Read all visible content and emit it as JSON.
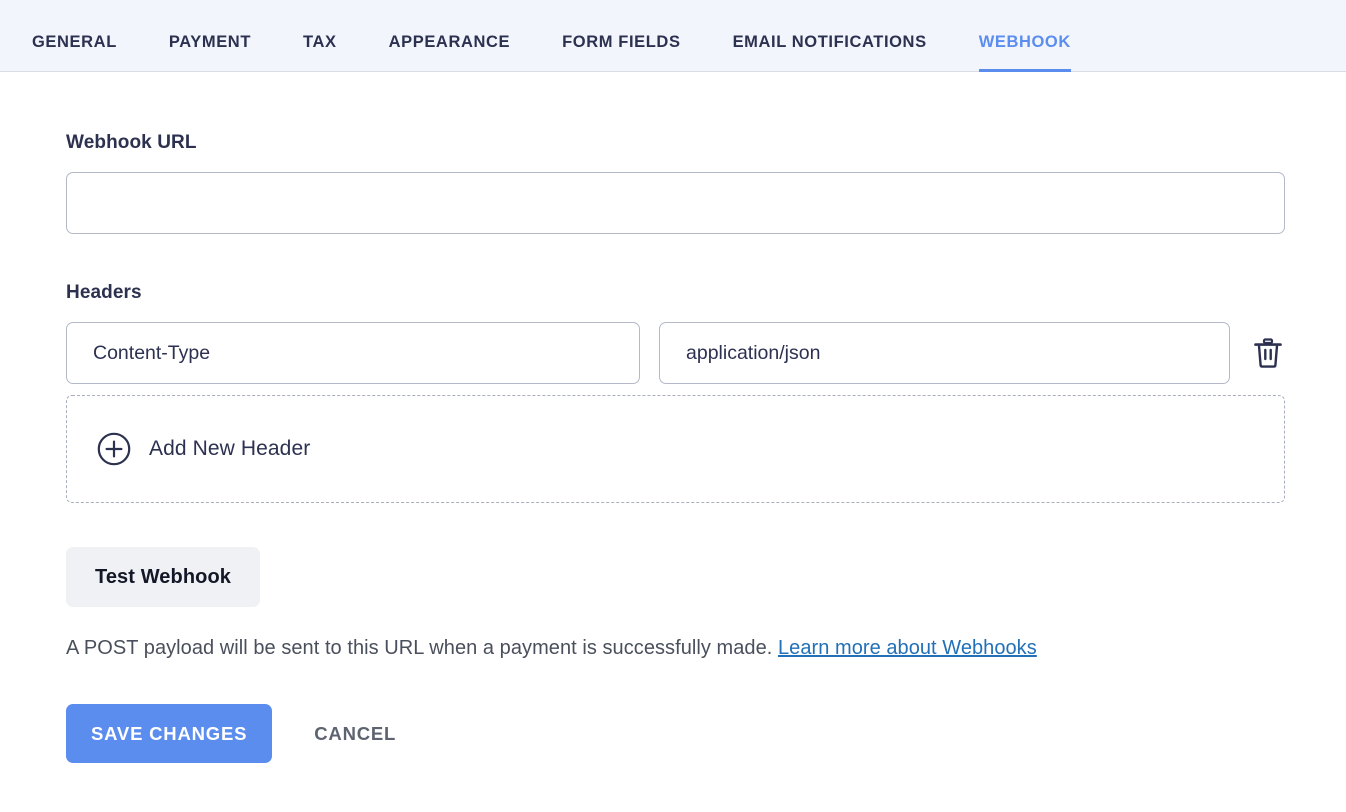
{
  "colors": {
    "tabbar_bg": "#f2f5fc",
    "accent_blue": "#5b8def",
    "link_blue": "#2170b8",
    "text_navy": "#2c3150",
    "muted_gray": "#5d6370",
    "input_border": "#b4b9c9",
    "test_button_bg": "#f0f1f5"
  },
  "tabs": [
    {
      "label": "GENERAL",
      "active": false
    },
    {
      "label": "PAYMENT",
      "active": false
    },
    {
      "label": "TAX",
      "active": false
    },
    {
      "label": "APPEARANCE",
      "active": false
    },
    {
      "label": "FORM FIELDS",
      "active": false
    },
    {
      "label": "EMAIL NOTIFICATIONS",
      "active": false
    },
    {
      "label": "WEBHOOK",
      "active": true
    }
  ],
  "webhook_url": {
    "label": "Webhook URL",
    "value": "",
    "placeholder": ""
  },
  "headers": {
    "label": "Headers",
    "rows": [
      {
        "key": "Content-Type",
        "value": "application/json",
        "key_placeholder": "",
        "value_placeholder": "",
        "delete_icon": "trash-icon"
      }
    ],
    "add_row": {
      "icon": "plus-circle-icon",
      "label": "Add New Header"
    }
  },
  "test_button": {
    "label": "Test Webhook"
  },
  "description": {
    "text": "A POST payload will be sent to this URL when a payment is successfully made.",
    "link_text": "Learn more about Webhooks"
  },
  "actions": {
    "save_label": "Save Changes",
    "cancel_label": "Cancel"
  }
}
